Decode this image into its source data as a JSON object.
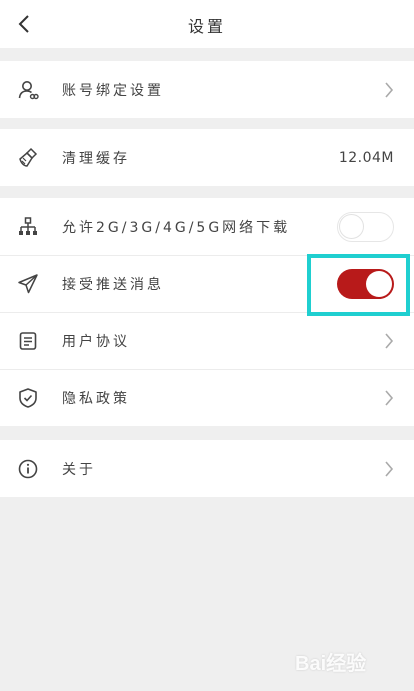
{
  "header": {
    "title": "设置",
    "back_icon": "chevron-left-icon"
  },
  "groups": [
    {
      "rows": [
        {
          "label": "账号绑定设置",
          "icon": "user-link-icon",
          "trailing": "chevron"
        }
      ]
    },
    {
      "rows": [
        {
          "label": "清理缓存",
          "icon": "broom-icon",
          "trailing": "value",
          "value": "12.04M"
        }
      ]
    },
    {
      "rows": [
        {
          "label": "允许2G/3G/4G/5G网络下载",
          "icon": "network-icon",
          "trailing": "toggle",
          "toggle_on": false
        },
        {
          "label": "接受推送消息",
          "icon": "send-icon",
          "trailing": "toggle",
          "toggle_on": true
        },
        {
          "label": "用户协议",
          "icon": "document-icon",
          "trailing": "chevron"
        },
        {
          "label": "隐私政策",
          "icon": "shield-check-icon",
          "trailing": "chevron"
        }
      ]
    },
    {
      "rows": [
        {
          "label": "关于",
          "icon": "info-icon",
          "trailing": "chevron"
        }
      ]
    }
  ],
  "colors": {
    "toggle_on": "#b81a1a",
    "highlight": "#1fcfd0",
    "background": "#efefef"
  },
  "watermark": {
    "text": "Bai经验"
  }
}
